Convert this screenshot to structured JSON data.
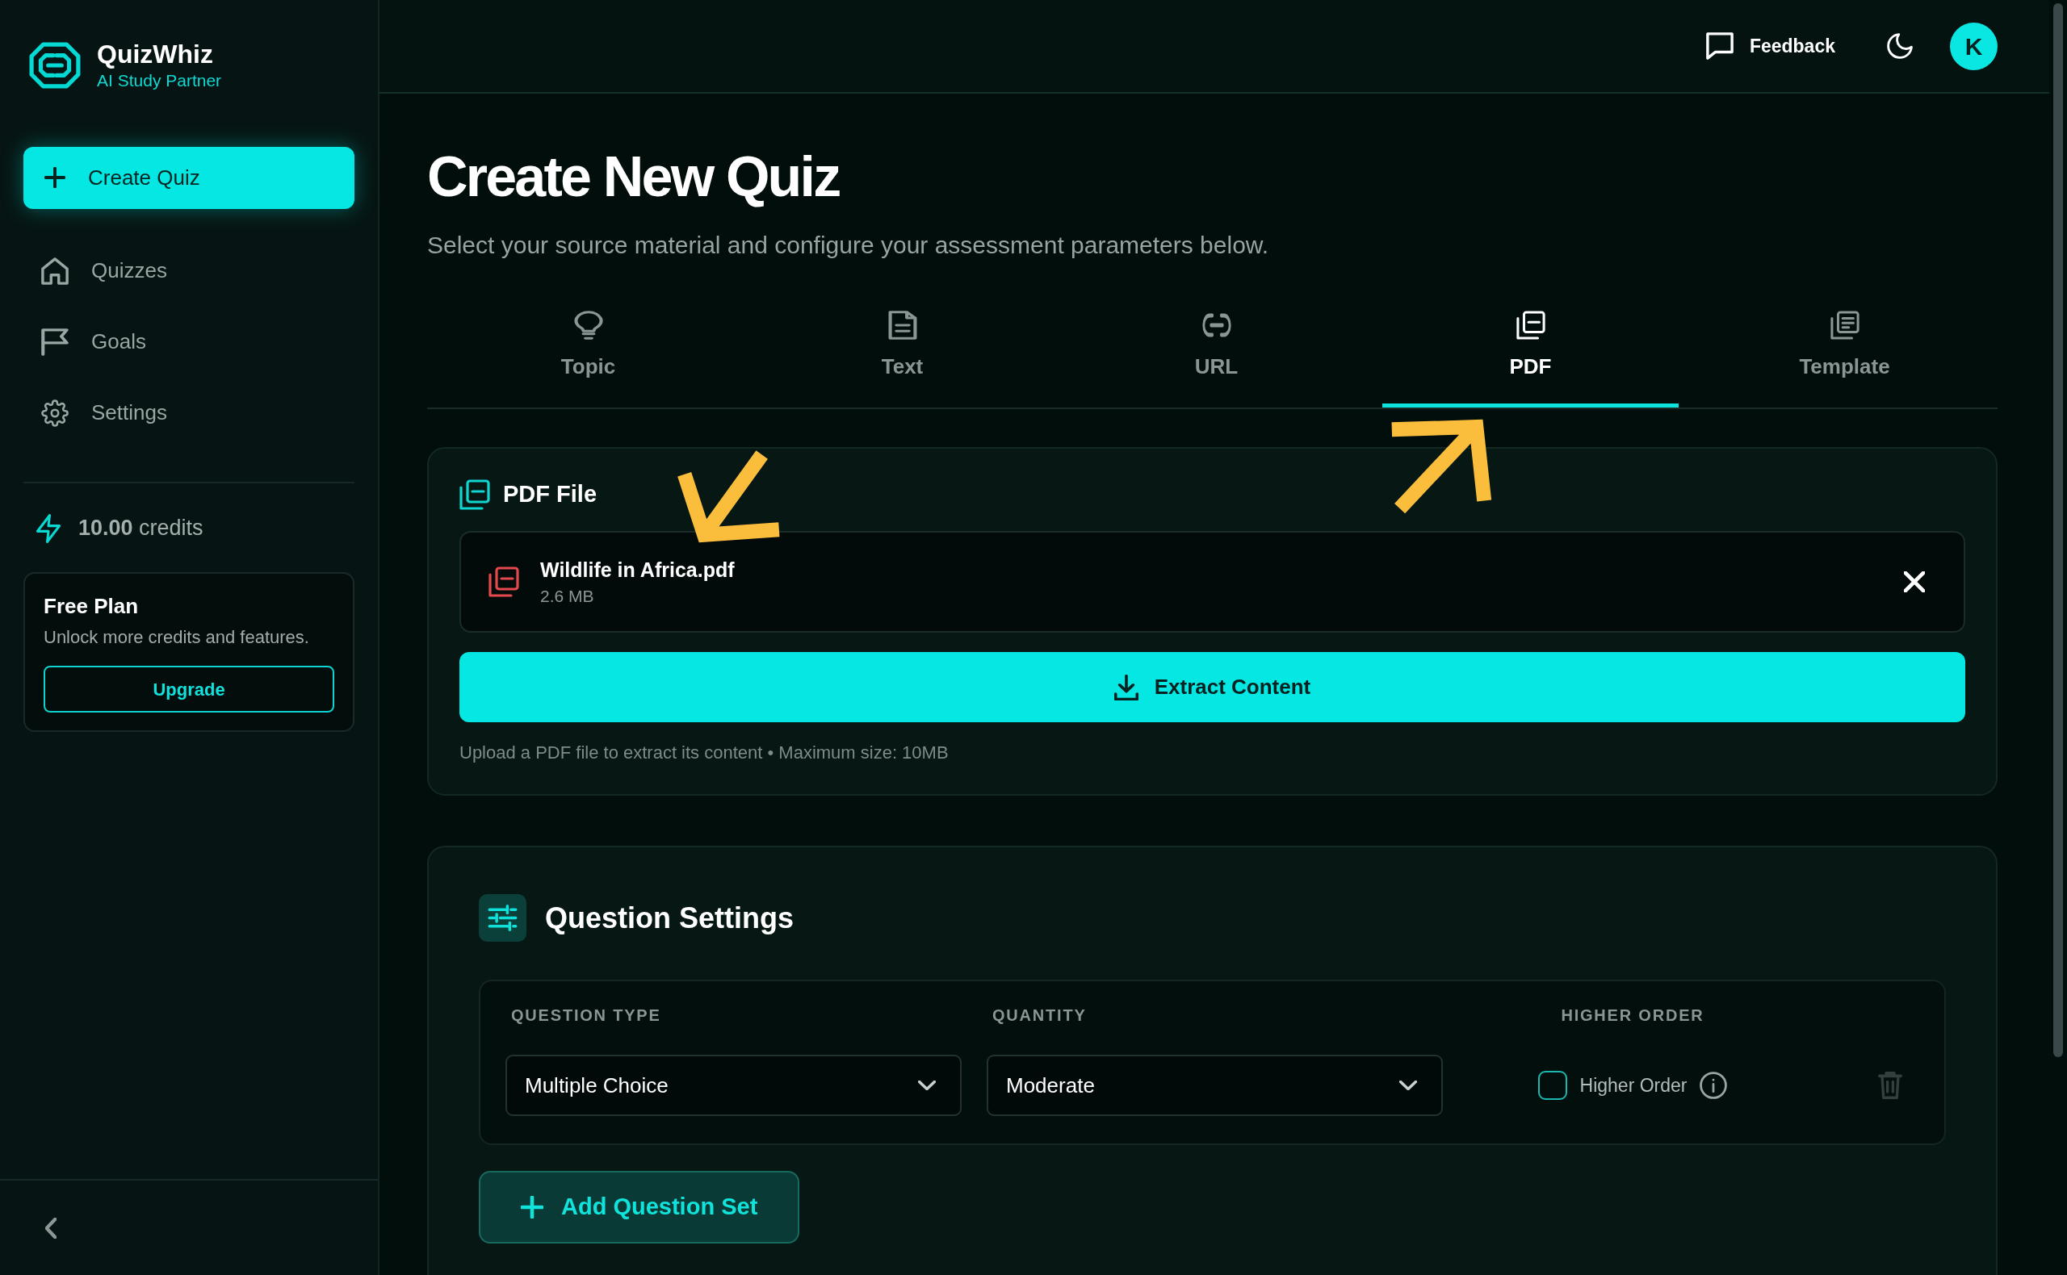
{
  "sidebar": {
    "brand": {
      "name": "QuizWhiz",
      "tagline": "AI Study Partner"
    },
    "create_button": "Create Quiz",
    "nav": [
      {
        "label": "Quizzes",
        "selected": false
      },
      {
        "label": "Goals",
        "selected": false
      },
      {
        "label": "Settings",
        "selected": false
      }
    ],
    "credits": "**10.00** credits",
    "plan": {
      "title": "Free Plan",
      "description": "Unlock more credits and features.",
      "button": "Upgrade"
    }
  },
  "header": {
    "feedback": "Feedback",
    "avatar": "K"
  },
  "page": {
    "title": "Create New Quiz",
    "subtitle": "Select your source material and configure your assessment parameters below."
  },
  "tabs": [
    {
      "label": "Topic",
      "selected": false
    },
    {
      "label": "Text",
      "selected": false
    },
    {
      "label": "URL",
      "selected": false
    },
    {
      "label": "PDF",
      "selected": true
    },
    {
      "label": "Template",
      "selected": false
    }
  ],
  "pdf_file": {
    "title": "PDF File",
    "file": {
      "name": "Wildlife in Africa.pdf",
      "size": "2.6 MB"
    },
    "button": "Extract Content",
    "hint": "Upload a PDF file to extract its content • Maximum size: 10MB"
  },
  "question_settings": {
    "title": "Question Settings",
    "columns": [
      "QUESTION TYPE",
      "QUANTITY",
      "HIGHER ORDER"
    ],
    "sets": [
      {
        "question_type": "Multiple Choice",
        "quantity": "Moderate",
        "higher_order": {
          "label": "Higher Order",
          "checked": false
        },
        "remove_button": {
          "disabled": true
        }
      }
    ],
    "add_button": "Add Question Set"
  }
}
